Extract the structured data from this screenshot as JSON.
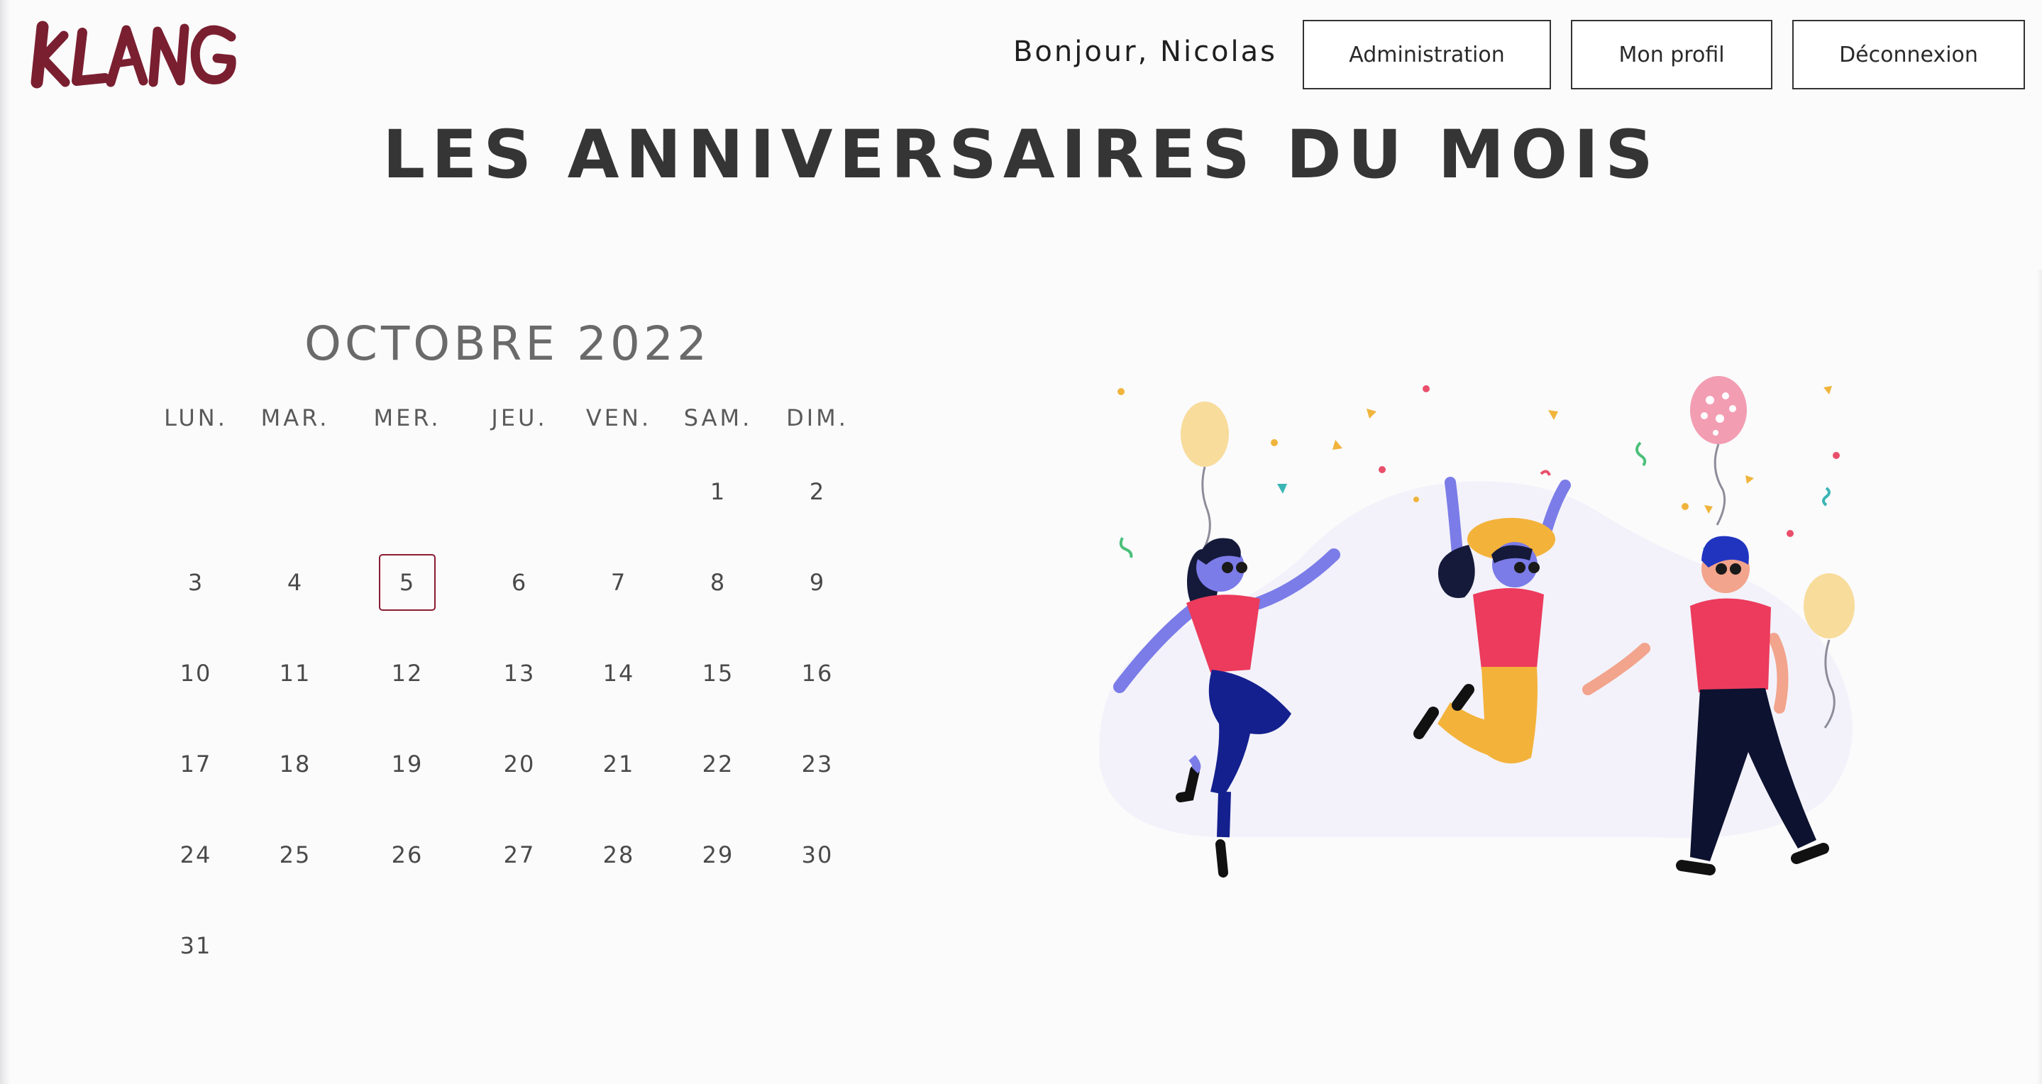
{
  "brand": {
    "logo_text": "KLANG",
    "color": "#7a1f30"
  },
  "header": {
    "greeting": "Bonjour, Nicolas",
    "buttons": {
      "administration": "Administration",
      "profile": "Mon profil",
      "logout": "Déconnexion"
    }
  },
  "page": {
    "title": "LES ANNIVERSAIRES DU MOIS"
  },
  "calendar": {
    "month_label": "OCTOBRE 2022",
    "weekdays": [
      "LUN.",
      "MAR.",
      "MER.",
      "JEU.",
      "VEN.",
      "SAM.",
      "DIM."
    ],
    "days": [
      "1",
      "2",
      "3",
      "4",
      "5",
      "6",
      "7",
      "8",
      "9",
      "10",
      "11",
      "12",
      "13",
      "14",
      "15",
      "16",
      "17",
      "18",
      "19",
      "20",
      "21",
      "22",
      "23",
      "24",
      "25",
      "26",
      "27",
      "28",
      "29",
      "30",
      "31"
    ],
    "first_weekday_index": 5,
    "today": "5",
    "today_border_color": "#8a1c34"
  },
  "illustration": {
    "icon": "birthday-party-illustration"
  }
}
